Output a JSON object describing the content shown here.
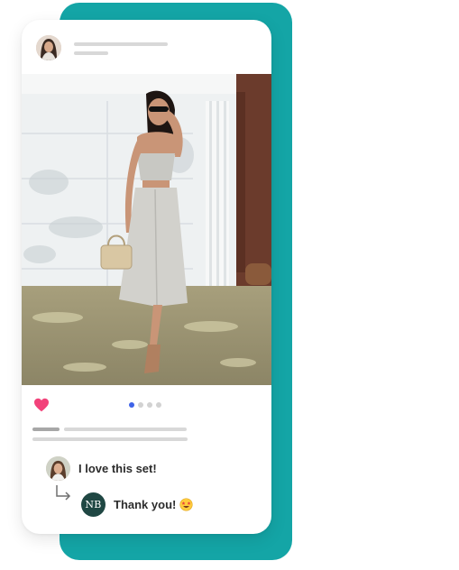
{
  "post": {
    "author_avatar_icon": "woman-portrait-avatar",
    "photo": {
      "description_icon": "fashion-photo-woman-in-white-skirt"
    },
    "like": {
      "icon": "heart-icon",
      "color": "#f2427a"
    },
    "carousel": {
      "total": 4,
      "active_index": 0,
      "active_color": "#3f63e8"
    }
  },
  "comments": [
    {
      "avatar_icon": "woman-portrait-avatar",
      "text": "I love this set!"
    },
    {
      "avatar_initials": "NB",
      "text": "Thank you!",
      "emoji_icon": "star-struck-emoji"
    }
  ],
  "colors": {
    "accent": "#14a5a6",
    "nb_avatar": "#1f4743"
  }
}
